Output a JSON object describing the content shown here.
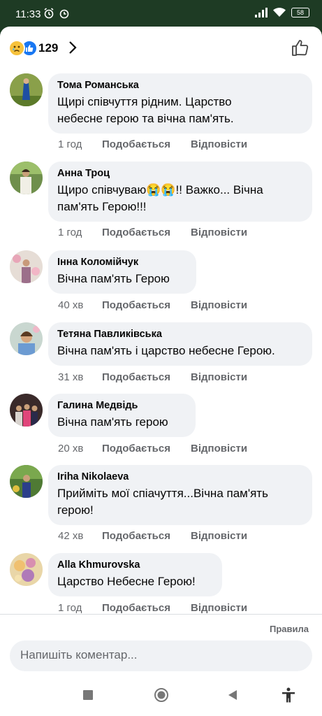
{
  "status": {
    "time": "11:33",
    "battery": "58"
  },
  "header": {
    "reaction_count": "129"
  },
  "comments": [
    {
      "name": "Тома Романська",
      "lines": [
        "Щирі співчуття рідним. Царство",
        "небесне герою та вічна пам'ять."
      ],
      "time": "1 год",
      "like": "Подобається",
      "reply": "Відповісти"
    },
    {
      "name": "Анна Троц",
      "lines": [
        "Щиро співчуваю😭😭!! Важко... Вічна",
        "пам'ять Герою!!!"
      ],
      "time": "1 год",
      "like": "Подобається",
      "reply": "Відповісти"
    },
    {
      "name": "Інна Коломійчук",
      "lines": [
        "Вічна пам'ять Герою"
      ],
      "time": "40 хв",
      "like": "Подобається",
      "reply": "Відповісти"
    },
    {
      "name": "Тетяна Павликівська",
      "lines": [
        "Вічна пам'ять і царство небесне Герою."
      ],
      "time": "31 хв",
      "like": "Подобається",
      "reply": "Відповісти"
    },
    {
      "name": "Галина Медвідь",
      "lines": [
        "Вічна пам'ять герою"
      ],
      "time": "20 хв",
      "like": "Подобається",
      "reply": "Відповісти"
    },
    {
      "name": "Iriha Nikolaeva",
      "lines": [
        "Прийміть мої спіачуття...Вічна пам'ять",
        "герою!"
      ],
      "time": "42 хв",
      "like": "Подобається",
      "reply": "Відповісти"
    },
    {
      "name": "Alla Khmurovska",
      "lines": [
        "Царство Небесне Герою!"
      ],
      "time": "1 год",
      "like": "Подобається",
      "reply": "Відповісти"
    }
  ],
  "footer": {
    "rules": "Правила",
    "placeholder": "Напишіть коментар..."
  },
  "icons": [
    "alarm-icon",
    "clock-icon",
    "signal-icon",
    "wifi-icon",
    "battery-icon",
    "sad-reaction-icon",
    "like-reaction-icon",
    "chevron-right-icon",
    "thumbs-up-icon",
    "square-icon",
    "circle-icon",
    "back-icon",
    "accessibility-icon"
  ],
  "colors": {
    "statusbar": "#1e3b24",
    "bubble": "#f0f2f5",
    "meta": "#65676b"
  }
}
